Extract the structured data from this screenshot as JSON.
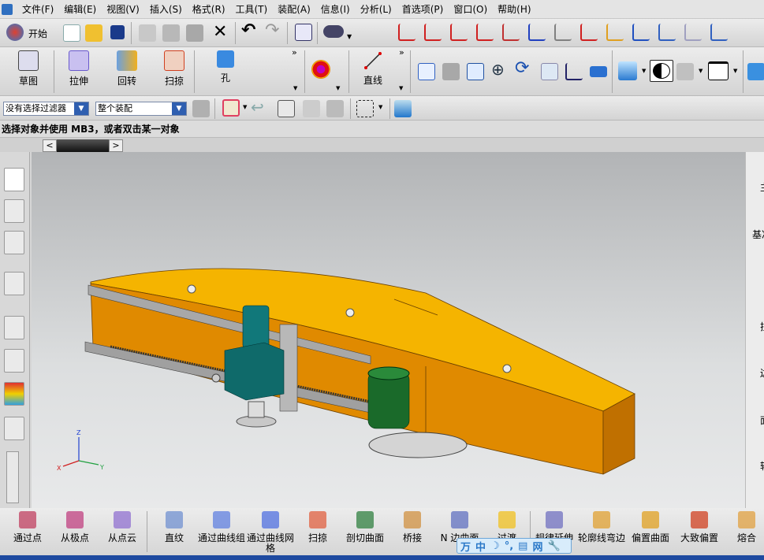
{
  "menu": [
    "文件(F)",
    "编辑(E)",
    "视图(V)",
    "插入(S)",
    "格式(R)",
    "工具(T)",
    "装配(A)",
    "信息(I)",
    "分析(L)",
    "首选项(P)",
    "窗口(O)",
    "帮助(H)"
  ],
  "toolbar1": {
    "start_label": "开始",
    "icons": [
      "new-file",
      "open-folder",
      "save",
      "cut",
      "copy",
      "paste",
      "delete",
      "undo",
      "redo",
      "information",
      "binoculars"
    ],
    "wcs_icons": [
      "wcs-dynamic",
      "wcs-origin",
      "wcs-rotate",
      "wcs-orient",
      "wcs-set-0",
      "wcs-xc",
      "wcs-yc",
      "wcs-save",
      "display-palette",
      "show",
      "show-hide",
      "hide",
      "invert-show"
    ]
  },
  "toolbar2": {
    "buttons": [
      "草图",
      "拉伸",
      "回转",
      "扫掠",
      "孔"
    ],
    "line_label": "直线"
  },
  "selection": {
    "filter": "没有选择过滤器",
    "scope": "整个装配"
  },
  "cue_line": "选择对象并使用 MB3，或者双击某一对象",
  "bottom_toolbar": [
    "通过点",
    "从极点",
    "从点云",
    "直纹",
    "通过曲线组",
    "通过曲线网格",
    "扫掠",
    "剖切曲面",
    "桥接",
    "N 边曲面",
    "过渡",
    "规律延伸",
    "轮廓线弯边",
    "偏置曲面",
    "大致偏置",
    "熔合"
  ],
  "right_panel": [
    "主",
    "基准",
    "拉",
    "边",
    "面",
    "转"
  ],
  "ime": [
    "万",
    "中",
    "☽",
    "°,",
    "▤",
    "网",
    "🔧"
  ],
  "colors": {
    "beam": "#e08a00",
    "beam_top": "#f5b400",
    "carriage": "#0f6a6a",
    "motor": "#1a6a2a",
    "accent_blue": "#1e4aa0"
  }
}
